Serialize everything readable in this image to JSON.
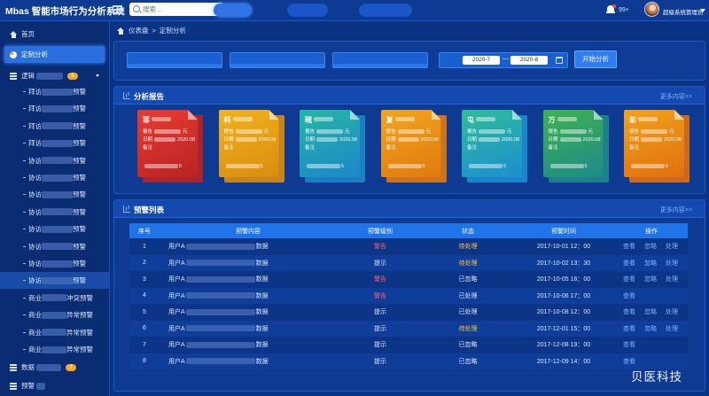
{
  "app": {
    "title": "Mbas 智能市场行为分析系统"
  },
  "search": {
    "placeholder": "搜索..."
  },
  "header": {
    "notification_count": "99+",
    "username": "超级系统管理员"
  },
  "sidebar": {
    "home": "首页",
    "custom": "定制分析",
    "group1": {
      "label": "逻辑",
      "badge": "5"
    },
    "sub_items": [
      {
        "prefix": "拜访",
        "suffix": "预警"
      },
      {
        "prefix": "拜访",
        "suffix": "预警"
      },
      {
        "prefix": "拜访",
        "suffix": "预警"
      },
      {
        "prefix": "拜访",
        "suffix": "预警"
      },
      {
        "prefix": "协访",
        "suffix": "预警"
      },
      {
        "prefix": "协访",
        "suffix": "预警"
      },
      {
        "prefix": "协访",
        "suffix": "预警"
      },
      {
        "prefix": "协访",
        "suffix": "预警"
      },
      {
        "prefix": "协访",
        "suffix": "预警"
      },
      {
        "prefix": "协访",
        "suffix": "预警"
      },
      {
        "prefix": "协访",
        "suffix": "预警"
      },
      {
        "prefix": "协访",
        "suffix": "预警"
      },
      {
        "prefix": "商业",
        "suffix": "冲突预警"
      },
      {
        "prefix": "商业",
        "suffix": "异常预警"
      },
      {
        "prefix": "商业",
        "suffix": "异常预警"
      },
      {
        "prefix": "商业",
        "suffix": "异常预警"
      }
    ],
    "group2": {
      "label": "数据",
      "badge": "2"
    },
    "group3": {
      "label": "预警"
    }
  },
  "breadcrumb": {
    "root": "仪表盘",
    "separator": ">",
    "current": "定制分析"
  },
  "filters": {
    "date_start": "2020-7",
    "date_sep": "—",
    "date_end": "2020-8",
    "start_button": "开始分析"
  },
  "report": {
    "title": "分析报告",
    "more": "更多内容>>",
    "cards": [
      {
        "title": "菲",
        "amount_suffix": "元",
        "date": "2020.08",
        "foot": "5"
      },
      {
        "title": "科",
        "amount_suffix": "元",
        "date": "2020.08",
        "foot": "5"
      },
      {
        "title": "晓",
        "amount_suffix": "元",
        "date": "2020.08",
        "foot": "5"
      },
      {
        "title": "复",
        "amount_suffix": "元",
        "date": "2020.08",
        "foot": "5"
      },
      {
        "title": "屯",
        "amount_suffix": "元",
        "date": "2020.08",
        "foot": "5"
      },
      {
        "title": "万",
        "amount_suffix": "元",
        "date": "2020.08",
        "foot": "5"
      },
      {
        "title": "彭",
        "amount_suffix": "元",
        "date": "2020.08",
        "foot": "5"
      }
    ],
    "card_labels": {
      "l1": "报告",
      "l2": "日期",
      "l3": "备注"
    },
    "card_colors": [
      [
        "#e83b33",
        "#b92323"
      ],
      [
        "#f2b21e",
        "#d98d0f"
      ],
      [
        "#27b6a6",
        "#1c86c9"
      ],
      [
        "#f2a51d",
        "#e07a10"
      ],
      [
        "#2fbd9a",
        "#1b8ed0"
      ],
      [
        "#3fb24f",
        "#1e8a8a"
      ],
      [
        "#f2a21d",
        "#e0700f"
      ]
    ]
  },
  "alerts": {
    "title": "预警列表",
    "more": "更多内容>>",
    "columns": [
      "序号",
      "预警内容",
      "预警级别",
      "状态",
      "预警时间",
      "操作"
    ],
    "content_prefix": "用户A",
    "content_suffix": "数据",
    "ops": {
      "view": "查看",
      "ignore": "忽略",
      "handle": "处理"
    },
    "rows": [
      {
        "no": "1",
        "level": "警告",
        "status": "待处理",
        "time": "2017-10-01  12：00",
        "ops": [
          "view",
          "ignore",
          "handle"
        ]
      },
      {
        "no": "2",
        "level": "提示",
        "status": "待处理",
        "time": "2017-10-02  13：30",
        "ops": [
          "view",
          "ignore",
          "handle"
        ]
      },
      {
        "no": "3",
        "level": "警告",
        "status": "已忽略",
        "time": "2017-10-05  16：00",
        "ops": [
          "view",
          "ignore",
          "handle"
        ]
      },
      {
        "no": "4",
        "level": "警告",
        "status": "已处理",
        "time": "2017-10-06  17：00",
        "ops": [
          "view"
        ]
      },
      {
        "no": "5",
        "level": "提示",
        "status": "已处理",
        "time": "2017-10-08  12：00",
        "ops": [
          "view",
          "ignore",
          "handle"
        ]
      },
      {
        "no": "6",
        "level": "提示",
        "status": "待处理",
        "time": "2017-12-01  15：00",
        "ops": [
          "view",
          "ignore",
          "handle"
        ]
      },
      {
        "no": "7",
        "level": "提示",
        "status": "已忽略",
        "time": "2017-12-08  19：00",
        "ops": [
          "view"
        ]
      },
      {
        "no": "8",
        "level": "提示",
        "status": "已忽略",
        "time": "2017-12-09  14：00",
        "ops": [
          "view"
        ]
      }
    ]
  },
  "watermark": "贝医科技"
}
